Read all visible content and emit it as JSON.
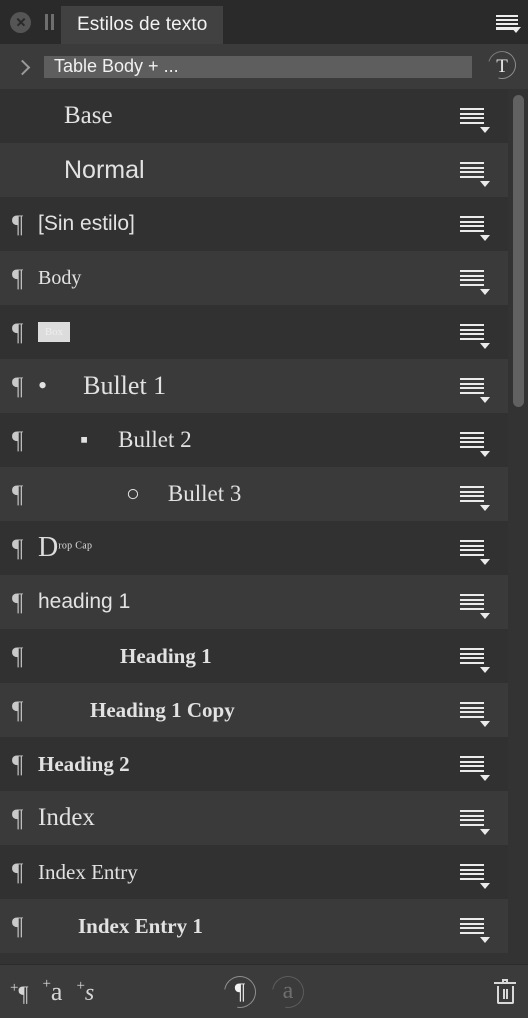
{
  "window": {
    "tab_title": "Estilos de texto",
    "close_icon": "close-icon",
    "pause_icon": "pause-icon",
    "panel_menu_icon": "panel-menu-icon"
  },
  "breadcrumb": {
    "expand_icon": "chevron-right-icon",
    "current_style": "Table Body + ...",
    "text_badge": "T"
  },
  "styles": [
    {
      "label": "Base",
      "kind": "none",
      "font": "serif",
      "size_class": "f-base",
      "indent": 26,
      "bullet": ""
    },
    {
      "label": "Normal",
      "kind": "none",
      "font": "sans",
      "size_class": "f-normal",
      "indent": 26,
      "bullet": ""
    },
    {
      "label": "[Sin estilo]",
      "kind": "paragraph",
      "font": "sans",
      "size_class": "f-sin",
      "indent": 0,
      "bullet": ""
    },
    {
      "label": "Body",
      "kind": "paragraph",
      "font": "serif",
      "size_class": "f-body",
      "indent": 0,
      "bullet": ""
    },
    {
      "label": "Box",
      "kind": "paragraph",
      "font": "serif",
      "size_class": "f-body",
      "indent": 0,
      "bullet": "",
      "swatch": true
    },
    {
      "label": "Bullet 1",
      "kind": "paragraph",
      "font": "serif",
      "size_class": "f-bul1",
      "indent": 0,
      "bullet": "•",
      "bullet_gap": 36
    },
    {
      "label": "Bullet 2",
      "kind": "paragraph",
      "font": "serif",
      "size_class": "f-bul2",
      "indent": 42,
      "bullet": "▪",
      "bullet_gap": 30
    },
    {
      "label": "Bullet 3",
      "kind": "paragraph",
      "font": "serif",
      "size_class": "f-bul3",
      "indent": 88,
      "bullet": "○",
      "bullet_gap": 28
    },
    {
      "label": "Drop Cap",
      "kind": "paragraph",
      "font": "serif",
      "size_class": "f-body",
      "indent": 0,
      "bullet": "",
      "dropcap": true
    },
    {
      "label": "heading 1",
      "kind": "paragraph",
      "font": "sans",
      "size_class": "f-h1low",
      "indent": 0,
      "bullet": ""
    },
    {
      "label": "Heading 1",
      "kind": "paragraph",
      "font": "serif",
      "size_class": "f-h1",
      "indent": 82,
      "bullet": ""
    },
    {
      "label": "Heading 1 Copy",
      "kind": "paragraph",
      "font": "serif",
      "size_class": "f-h1c",
      "indent": 52,
      "bullet": ""
    },
    {
      "label": "Heading 2",
      "kind": "paragraph",
      "font": "serif",
      "size_class": "f-h2",
      "indent": 0,
      "bullet": ""
    },
    {
      "label": "Index",
      "kind": "paragraph",
      "font": "serif",
      "size_class": "f-index",
      "indent": 0,
      "bullet": ""
    },
    {
      "label": "Index Entry",
      "kind": "paragraph",
      "font": "serif",
      "size_class": "f-ie",
      "indent": 0,
      "bullet": ""
    },
    {
      "label": "Index Entry 1",
      "kind": "paragraph",
      "font": "serif",
      "size_class": "f-ie1",
      "indent": 40,
      "bullet": ""
    }
  ],
  "dropcap": {
    "big": "D",
    "small": "rop Cap"
  },
  "row_menu_icon": "list-options-icon",
  "toolbar": {
    "new_paragraph_style": {
      "plus": "+",
      "glyph": "¶",
      "name": "new-paragraph-style-button"
    },
    "new_character_style": {
      "plus": "+",
      "glyph": "a",
      "name": "new-character-style-button"
    },
    "new_set_style": {
      "plus": "+",
      "glyph": "s",
      "name": "new-style-set-button"
    },
    "filter_paragraph": {
      "glyph": "¶",
      "active": true
    },
    "filter_character": {
      "glyph": "a",
      "active": false
    },
    "delete_icon": "trash-icon"
  },
  "colors": {
    "panel_bg": "#333333",
    "row_alt": "#3a3a3a",
    "row_base": "#313131",
    "tab_active": "#414141",
    "crumb_field": "#5e5e5e",
    "text": "#e2e2e2",
    "scrollbar_thumb": "#616161"
  }
}
